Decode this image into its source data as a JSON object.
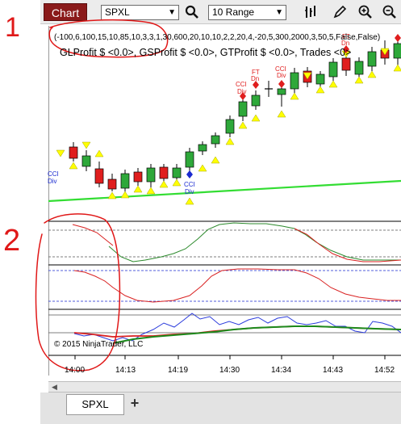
{
  "toolbar": {
    "chart_button": "Chart",
    "instrument": "SPXL",
    "period": "10 Range",
    "icons": [
      "search-icon",
      "bar-type-icon",
      "draw-pencil-icon",
      "zoom-in-icon",
      "zoom-out-icon"
    ]
  },
  "chart": {
    "params": "(-100,6,100,15,10,85,10,3,3,1,30,600,20,10,10,2,2,20,4,-20,5,300,2000,3,50,5,False,False)",
    "profit": "GLProfit $ <0.0>, GSProfit $ <0.0>, GTProfit $ <0.0>, Trades <0>",
    "copyright": "© 2015 NinjaTrader, LLC",
    "x_labels": [
      "14:00",
      "14:13",
      "14:19",
      "14:30",
      "14:34",
      "14:43",
      "14:52"
    ],
    "signal_labels": {
      "cci": "CCI",
      "div": "Div",
      "ft": "FT",
      "dn": "Dn"
    },
    "colors": {
      "bull": "#2ea83a",
      "bear": "#e01e1e",
      "signal_up": "#ffff00",
      "sma": "#33dd33"
    }
  },
  "annotations": {
    "one": "1",
    "two": "2"
  },
  "tabs": {
    "active": "SPXL",
    "add": "+"
  }
}
